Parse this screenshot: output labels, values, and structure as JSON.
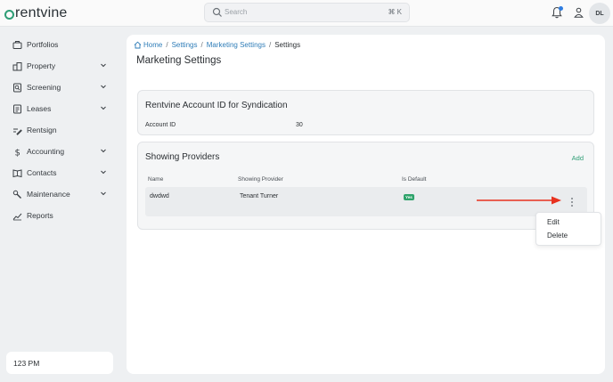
{
  "app": {
    "logo_text": "rentvine",
    "brand_color": "#2f9e76"
  },
  "search": {
    "placeholder": "Search",
    "shortcut": "⌘ K"
  },
  "header": {
    "avatar_initials": "DL"
  },
  "sidebar": {
    "items": [
      {
        "label": "Portfolios",
        "icon": "portfolio-icon",
        "expandable": false
      },
      {
        "label": "Property",
        "icon": "property-icon",
        "expandable": true
      },
      {
        "label": "Screening",
        "icon": "screening-icon",
        "expandable": true
      },
      {
        "label": "Leases",
        "icon": "leases-icon",
        "expandable": true
      },
      {
        "label": "Rentsign",
        "icon": "rentsign-icon",
        "expandable": false
      },
      {
        "label": "Accounting",
        "icon": "dollar-icon",
        "expandable": true
      },
      {
        "label": "Contacts",
        "icon": "contacts-icon",
        "expandable": true
      },
      {
        "label": "Maintenance",
        "icon": "wrench-icon",
        "expandable": true
      },
      {
        "label": "Reports",
        "icon": "chart-icon",
        "expandable": false
      }
    ],
    "clock": "123 PM"
  },
  "breadcrumb": {
    "home": "Home",
    "settings": "Settings",
    "marketing": "Marketing Settings",
    "current": "Settings"
  },
  "page_title": "Marketing Settings",
  "syndication_card": {
    "title": "Rentvine Account ID for Syndication",
    "account_id_label": "Account ID",
    "account_id_value": "30"
  },
  "providers_card": {
    "title": "Showing Providers",
    "add_label": "Add",
    "columns": [
      "Name",
      "Showing Provider",
      "Is Default"
    ],
    "rows": [
      {
        "name": "dwdwd",
        "provider": "Tenant Turner",
        "is_default": "Yes"
      }
    ]
  },
  "row_menu": {
    "items": [
      "Edit",
      "Delete"
    ]
  },
  "annotation": {
    "arrow_color": "#e8321f"
  }
}
